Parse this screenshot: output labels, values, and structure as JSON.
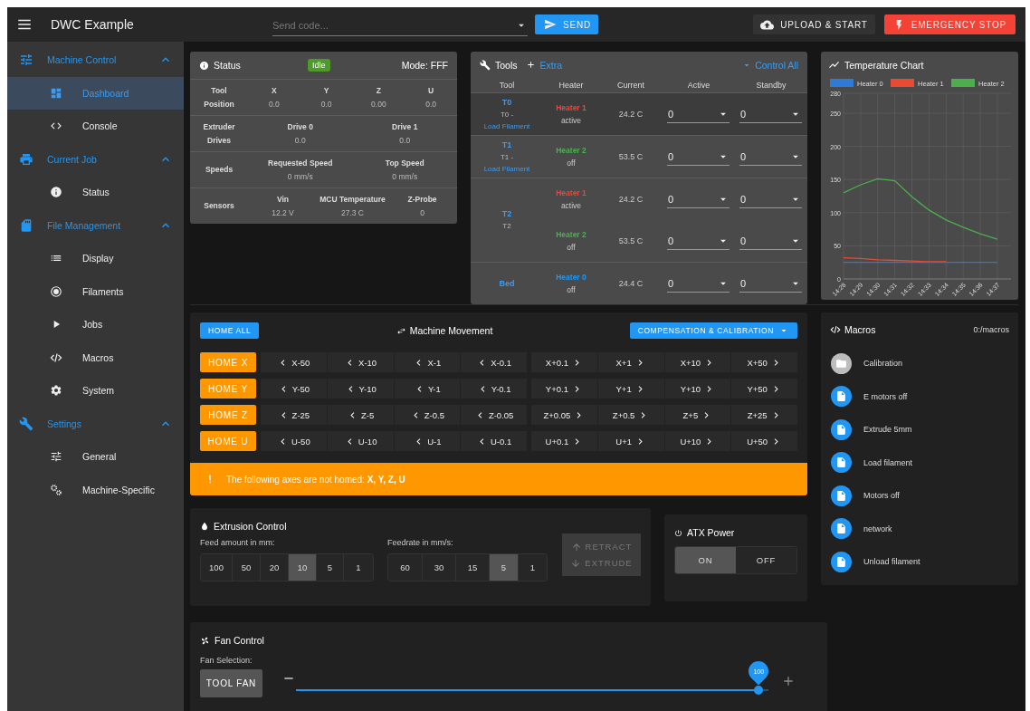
{
  "topbar": {
    "title": "DWC Example",
    "code_placeholder": "Send code...",
    "send_label": "SEND",
    "upload_label": "UPLOAD & START",
    "estop_label": "EMERGENCY STOP"
  },
  "sidebar": {
    "groups": [
      {
        "label": "Machine Control",
        "expanded": true,
        "items": [
          {
            "label": "Dashboard",
            "selected": true
          },
          {
            "label": "Console",
            "selected": false
          }
        ]
      },
      {
        "label": "Current Job",
        "expanded": true,
        "items": [
          {
            "label": "Status",
            "selected": false
          }
        ]
      },
      {
        "label": "File Management",
        "expanded": true,
        "items": [
          {
            "label": "Display",
            "selected": false
          },
          {
            "label": "Filaments",
            "selected": false
          },
          {
            "label": "Jobs",
            "selected": false
          },
          {
            "label": "Macros",
            "selected": false
          },
          {
            "label": "System",
            "selected": false
          }
        ]
      },
      {
        "label": "Settings",
        "expanded": true,
        "items": [
          {
            "label": "General",
            "selected": false
          },
          {
            "label": "Machine-Specific",
            "selected": false
          }
        ]
      }
    ]
  },
  "status": {
    "title": "Status",
    "state": "Idle",
    "mode": "Mode: FFF",
    "sections": [
      {
        "label": "Tool Position",
        "items": [
          {
            "name": "X",
            "value": "0.0"
          },
          {
            "name": "Y",
            "value": "0.0"
          },
          {
            "name": "Z",
            "value": "0.00"
          },
          {
            "name": "U",
            "value": "0.0"
          }
        ]
      },
      {
        "label": "Extruder Drives",
        "items": [
          {
            "name": "Drive 0",
            "value": "0.0"
          },
          {
            "name": "Drive 1",
            "value": "0.0"
          }
        ]
      },
      {
        "label": "Speeds",
        "items": [
          {
            "name": "Requested Speed",
            "value": "0 mm/s"
          },
          {
            "name": "Top Speed",
            "value": "0 mm/s"
          }
        ]
      },
      {
        "label": "Sensors",
        "items": [
          {
            "name": "Vin",
            "value": "12.2 V"
          },
          {
            "name": "MCU Temperature",
            "value": "27.3 C"
          },
          {
            "name": "Z-Probe",
            "value": "0"
          }
        ]
      }
    ]
  },
  "tools": {
    "title": "Tools",
    "extra_label": "Extra",
    "control_all_label": "Control All",
    "columns": [
      "Tool",
      "Heater",
      "Current",
      "Active",
      "Standby"
    ],
    "rows": [
      {
        "name": "T0",
        "subtitle": "T0 -",
        "load_link": "Load Filament",
        "selected": true,
        "heaters": [
          {
            "name": "Heater 1",
            "color": "#f44336",
            "state": "active",
            "current": "24.2 C",
            "active": "0",
            "standby": "0"
          }
        ]
      },
      {
        "name": "T1",
        "subtitle": "T1 -",
        "load_link": "Load Filament",
        "selected": false,
        "heaters": [
          {
            "name": "Heater 2",
            "color": "#4caf50",
            "state": "off",
            "current": "53.5 C",
            "active": "0",
            "standby": "0"
          }
        ]
      },
      {
        "name": "T2",
        "subtitle": "T2",
        "selected": false,
        "heaters": [
          {
            "name": "Heater 1",
            "color": "#f44336",
            "state": "active",
            "current": "24.2 C",
            "active": "0",
            "standby": "0"
          },
          {
            "name": "Heater 2",
            "color": "#4caf50",
            "state": "off",
            "current": "53.5 C",
            "active": "0",
            "standby": "0"
          }
        ]
      },
      {
        "name": "Bed",
        "selected": false,
        "heaters": [
          {
            "name": "Heater 0",
            "color": "#2196f3",
            "state": "off",
            "current": "24.4 C",
            "active": "0",
            "standby": "0"
          }
        ]
      }
    ]
  },
  "temperature": {
    "title": "Temperature Chart",
    "chart_data": {
      "type": "line",
      "categories": [
        "14:28",
        "14:29",
        "14:30",
        "14:31",
        "14:32",
        "14:33",
        "14:34",
        "14:35",
        "14:36",
        "14:37"
      ],
      "ylim": [
        0,
        280
      ],
      "yticks": [
        0,
        50,
        100,
        150,
        200,
        250,
        280
      ],
      "grid": true,
      "legend": "top",
      "series": [
        {
          "name": "Heater 0",
          "color": "#2e7ad6",
          "values": [
            25,
            25,
            25,
            25,
            25,
            25,
            25,
            25,
            25,
            25
          ]
        },
        {
          "name": "Heater 1",
          "color": "#e84a32",
          "values": [
            32,
            31,
            29,
            28,
            27,
            26,
            26,
            null,
            null,
            null
          ]
        },
        {
          "name": "Heater 2",
          "color": "#4cae4c",
          "values": [
            130,
            142,
            151,
            148,
            124,
            104,
            89,
            78,
            68,
            60
          ]
        }
      ]
    }
  },
  "movement": {
    "home_all_label": "HOME ALL",
    "title": "Machine Movement",
    "compensation_label": "COMPENSATION & CALIBRATION",
    "axes": [
      {
        "home_label": "HOME X",
        "steps": [
          "X-50",
          "X-10",
          "X-1",
          "X-0.1",
          "X+0.1",
          "X+1",
          "X+10",
          "X+50"
        ]
      },
      {
        "home_label": "HOME Y",
        "steps": [
          "Y-50",
          "Y-10",
          "Y-1",
          "Y-0.1",
          "Y+0.1",
          "Y+1",
          "Y+10",
          "Y+50"
        ]
      },
      {
        "home_label": "HOME Z",
        "steps": [
          "Z-25",
          "Z-5",
          "Z-0.5",
          "Z-0.05",
          "Z+0.05",
          "Z+0.5",
          "Z+5",
          "Z+25"
        ]
      },
      {
        "home_label": "HOME U",
        "steps": [
          "U-50",
          "U-10",
          "U-1",
          "U-0.1",
          "U+0.1",
          "U+1",
          "U+10",
          "U+50"
        ]
      }
    ],
    "warning": "The following axes are not homed: **X, Y, Z, U**"
  },
  "macros": {
    "title": "Macros",
    "path": "0:/macros",
    "items": [
      {
        "kind": "folder",
        "label": "Calibration"
      },
      {
        "kind": "file",
        "label": "E motors off"
      },
      {
        "kind": "file",
        "label": "Extrude 5mm"
      },
      {
        "kind": "file",
        "label": "Load filament"
      },
      {
        "kind": "file",
        "label": "Motors off"
      },
      {
        "kind": "file",
        "label": "network"
      },
      {
        "kind": "file",
        "label": "Unload filament"
      }
    ]
  },
  "extrusion": {
    "title": "Extrusion Control",
    "feed_label": "Feed amount in mm:",
    "feed_amounts": [
      {
        "label": "100",
        "selected": false
      },
      {
        "label": "50",
        "selected": false
      },
      {
        "label": "20",
        "selected": false
      },
      {
        "label": "10",
        "selected": true
      },
      {
        "label": "5",
        "selected": false
      },
      {
        "label": "1",
        "selected": false
      }
    ],
    "feedrate_label": "Feedrate in mm/s:",
    "feedrates": [
      {
        "label": "60",
        "selected": false
      },
      {
        "label": "30",
        "selected": false
      },
      {
        "label": "15",
        "selected": false
      },
      {
        "label": "5",
        "selected": true
      },
      {
        "label": "1",
        "selected": false
      }
    ],
    "retract_label": "RETRACT",
    "extrude_label": "EXTRUDE",
    "disabled": true
  },
  "atx": {
    "title": "ATX Power",
    "options": [
      {
        "label": "ON",
        "selected": true
      },
      {
        "label": "OFF",
        "selected": false
      }
    ]
  },
  "fan": {
    "title": "Fan Control",
    "selection_label": "Fan Selection:",
    "fan_button": "TOOL FAN",
    "slider": {
      "level": 1,
      "reading": "100"
    }
  }
}
